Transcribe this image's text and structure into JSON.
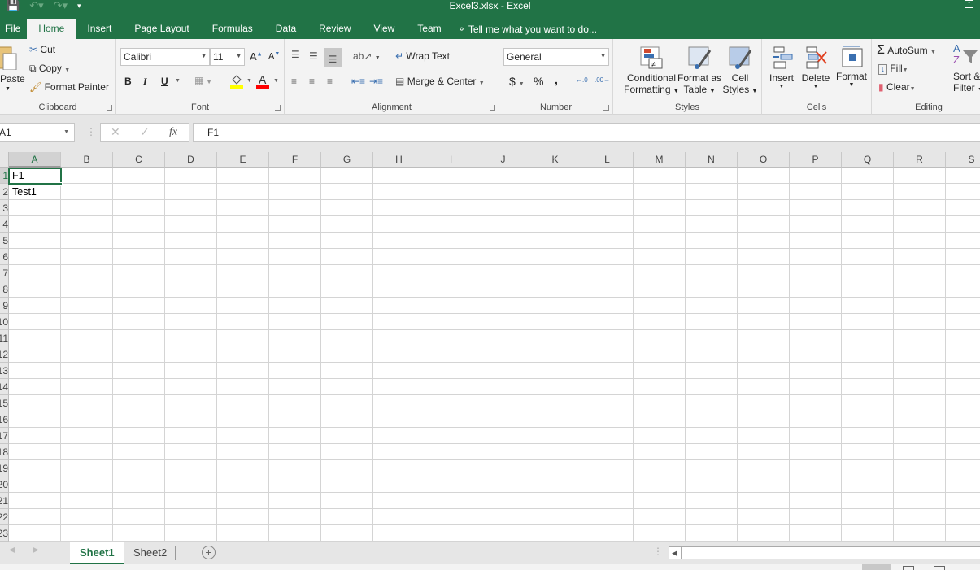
{
  "window": {
    "title": "Excel3.xlsx - Excel"
  },
  "qat": {
    "save": "save-icon",
    "undo": "undo-icon",
    "redo": "redo-icon",
    "customize": "customize-qat-icon"
  },
  "tabs": [
    {
      "label": "File"
    },
    {
      "label": "Home",
      "active": true
    },
    {
      "label": "Insert"
    },
    {
      "label": "Page Layout"
    },
    {
      "label": "Formulas"
    },
    {
      "label": "Data"
    },
    {
      "label": "Review"
    },
    {
      "label": "View"
    },
    {
      "label": "Team"
    }
  ],
  "tell_me": "Tell me what you want to do...",
  "ribbon": {
    "clipboard": {
      "label": "Clipboard",
      "paste": "Paste",
      "cut": "Cut",
      "copy": "Copy",
      "format_painter": "Format Painter"
    },
    "font": {
      "label": "Font",
      "font_name": "Calibri",
      "font_size": "11",
      "bold": "B",
      "italic": "I",
      "underline": "U",
      "highlight_color": "#ffff00",
      "font_color": "#ff0000"
    },
    "alignment": {
      "label": "Alignment",
      "wrap_text": "Wrap Text",
      "merge_center": "Merge & Center"
    },
    "number": {
      "label": "Number",
      "format": "General",
      "currency": "$",
      "percent": "%",
      "comma": ","
    },
    "styles": {
      "label": "Styles",
      "conditional_1": "Conditional",
      "conditional_2": "Formatting",
      "format_table_1": "Format as",
      "format_table_2": "Table",
      "cell_styles_1": "Cell",
      "cell_styles_2": "Styles"
    },
    "cells": {
      "label": "Cells",
      "insert": "Insert",
      "delete": "Delete",
      "format": "Format"
    },
    "editing": {
      "label": "Editing",
      "autosum": "AutoSum",
      "fill": "Fill",
      "clear": "Clear",
      "sort_1": "Sort &",
      "sort_2": "Filter"
    }
  },
  "formula_bar": {
    "name_box": "A1",
    "fx": "fx",
    "value": "F1"
  },
  "grid": {
    "columns": [
      "A",
      "B",
      "C",
      "D",
      "E",
      "F",
      "G",
      "H",
      "I",
      "J",
      "K",
      "L",
      "M",
      "N",
      "O",
      "P",
      "Q",
      "R",
      "S"
    ],
    "rows": [
      "1",
      "2",
      "3",
      "4",
      "5",
      "6",
      "7",
      "8",
      "9",
      "10",
      "11",
      "12",
      "13",
      "14",
      "15",
      "16",
      "17",
      "18",
      "19",
      "20",
      "21",
      "22",
      "23"
    ],
    "selected_cell": "A1",
    "cells": [
      {
        "ref": "A1",
        "col": 0,
        "row": 0,
        "value": "F1"
      },
      {
        "ref": "A2",
        "col": 0,
        "row": 1,
        "value": "Test1"
      }
    ]
  },
  "sheets": [
    {
      "label": "Sheet1",
      "active": true
    },
    {
      "label": "Sheet2",
      "active": false
    }
  ],
  "accent": "#217346"
}
